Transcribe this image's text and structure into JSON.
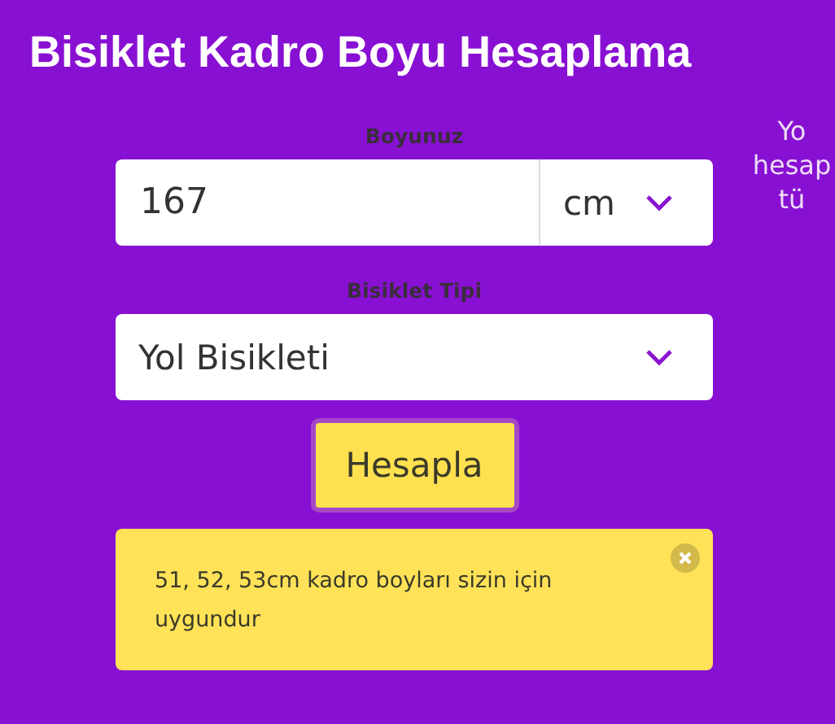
{
  "title": "Bisiklet Kadro Boyu Hesaplama",
  "height_field": {
    "label": "Boyunuz",
    "value": "167",
    "unit": "cm"
  },
  "bike_type": {
    "label": "Bisiklet Tipi",
    "value": "Yol Bisikleti"
  },
  "button": "Hesapla",
  "alert": {
    "text": "51, 52, 53cm kadro boyları sizin için uygundur",
    "closable": true
  },
  "side_text": [
    "Yo",
    "hesap",
    "tü"
  ]
}
